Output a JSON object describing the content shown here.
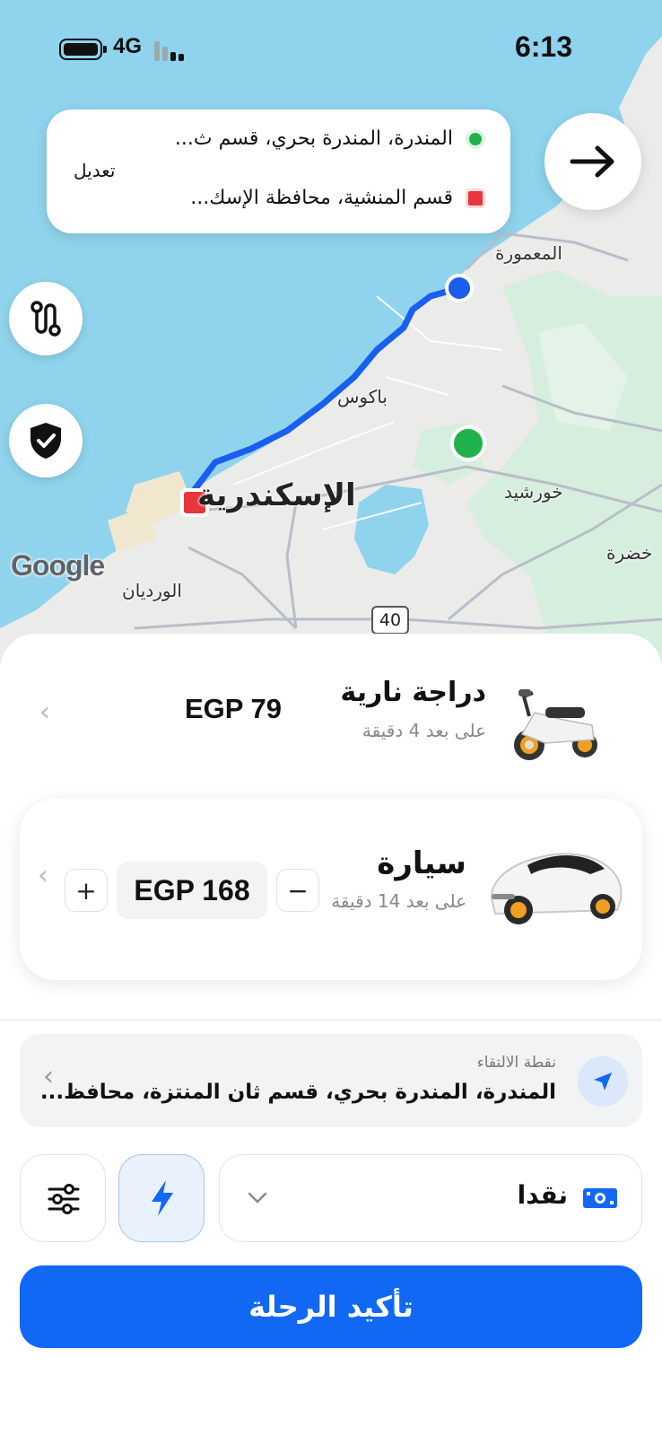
{
  "status_bar": {
    "network": "4G",
    "time": "6:13"
  },
  "map": {
    "labels": {
      "maamoura": "المعمورة",
      "bakos": "باكوس",
      "alexandria": "الإسكندرية",
      "khorshid": "خورشيد",
      "khadra": "خضرة",
      "wardian": "الورديان"
    },
    "road_shield": "40",
    "attribution": "Google"
  },
  "route": {
    "pickup": "المندرة، المندرة بحري، قسم ث...",
    "dropoff": "قسم المنشية، محافظة الإسك...",
    "edit_label": "تعديل"
  },
  "icons": {
    "back": "arrow-right-icon",
    "route_options": "route-icon",
    "safety": "shield-check-icon",
    "location": "navigation-arrow-icon",
    "filters": "sliders-icon",
    "fast": "lightning-icon",
    "cash": "cash-icon"
  },
  "vehicles": [
    {
      "name": "دراجة نارية",
      "eta": "على بعد 4 دقيقة",
      "price": "EGP 79",
      "icon": "motorbike-icon"
    },
    {
      "name": "سيارة",
      "eta": "على بعد 14 دقيقة",
      "price": "EGP 168",
      "icon": "car-icon",
      "selected": true
    }
  ],
  "stepper": {
    "minus": "−",
    "plus": "+"
  },
  "pickup_field": {
    "label": "نقطة الالتقاء",
    "address": "المندرة، المندرة بحري، قسم ثان المنتزة، محافظ..."
  },
  "payment": {
    "method": "نقدا"
  },
  "confirm_button": "تأكيد الرحلة",
  "colors": {
    "primary": "#1168F4",
    "pickup_dot": "#1FB24A",
    "dropoff_marker": "#E8363D",
    "route_line": "#1a5ef0"
  }
}
